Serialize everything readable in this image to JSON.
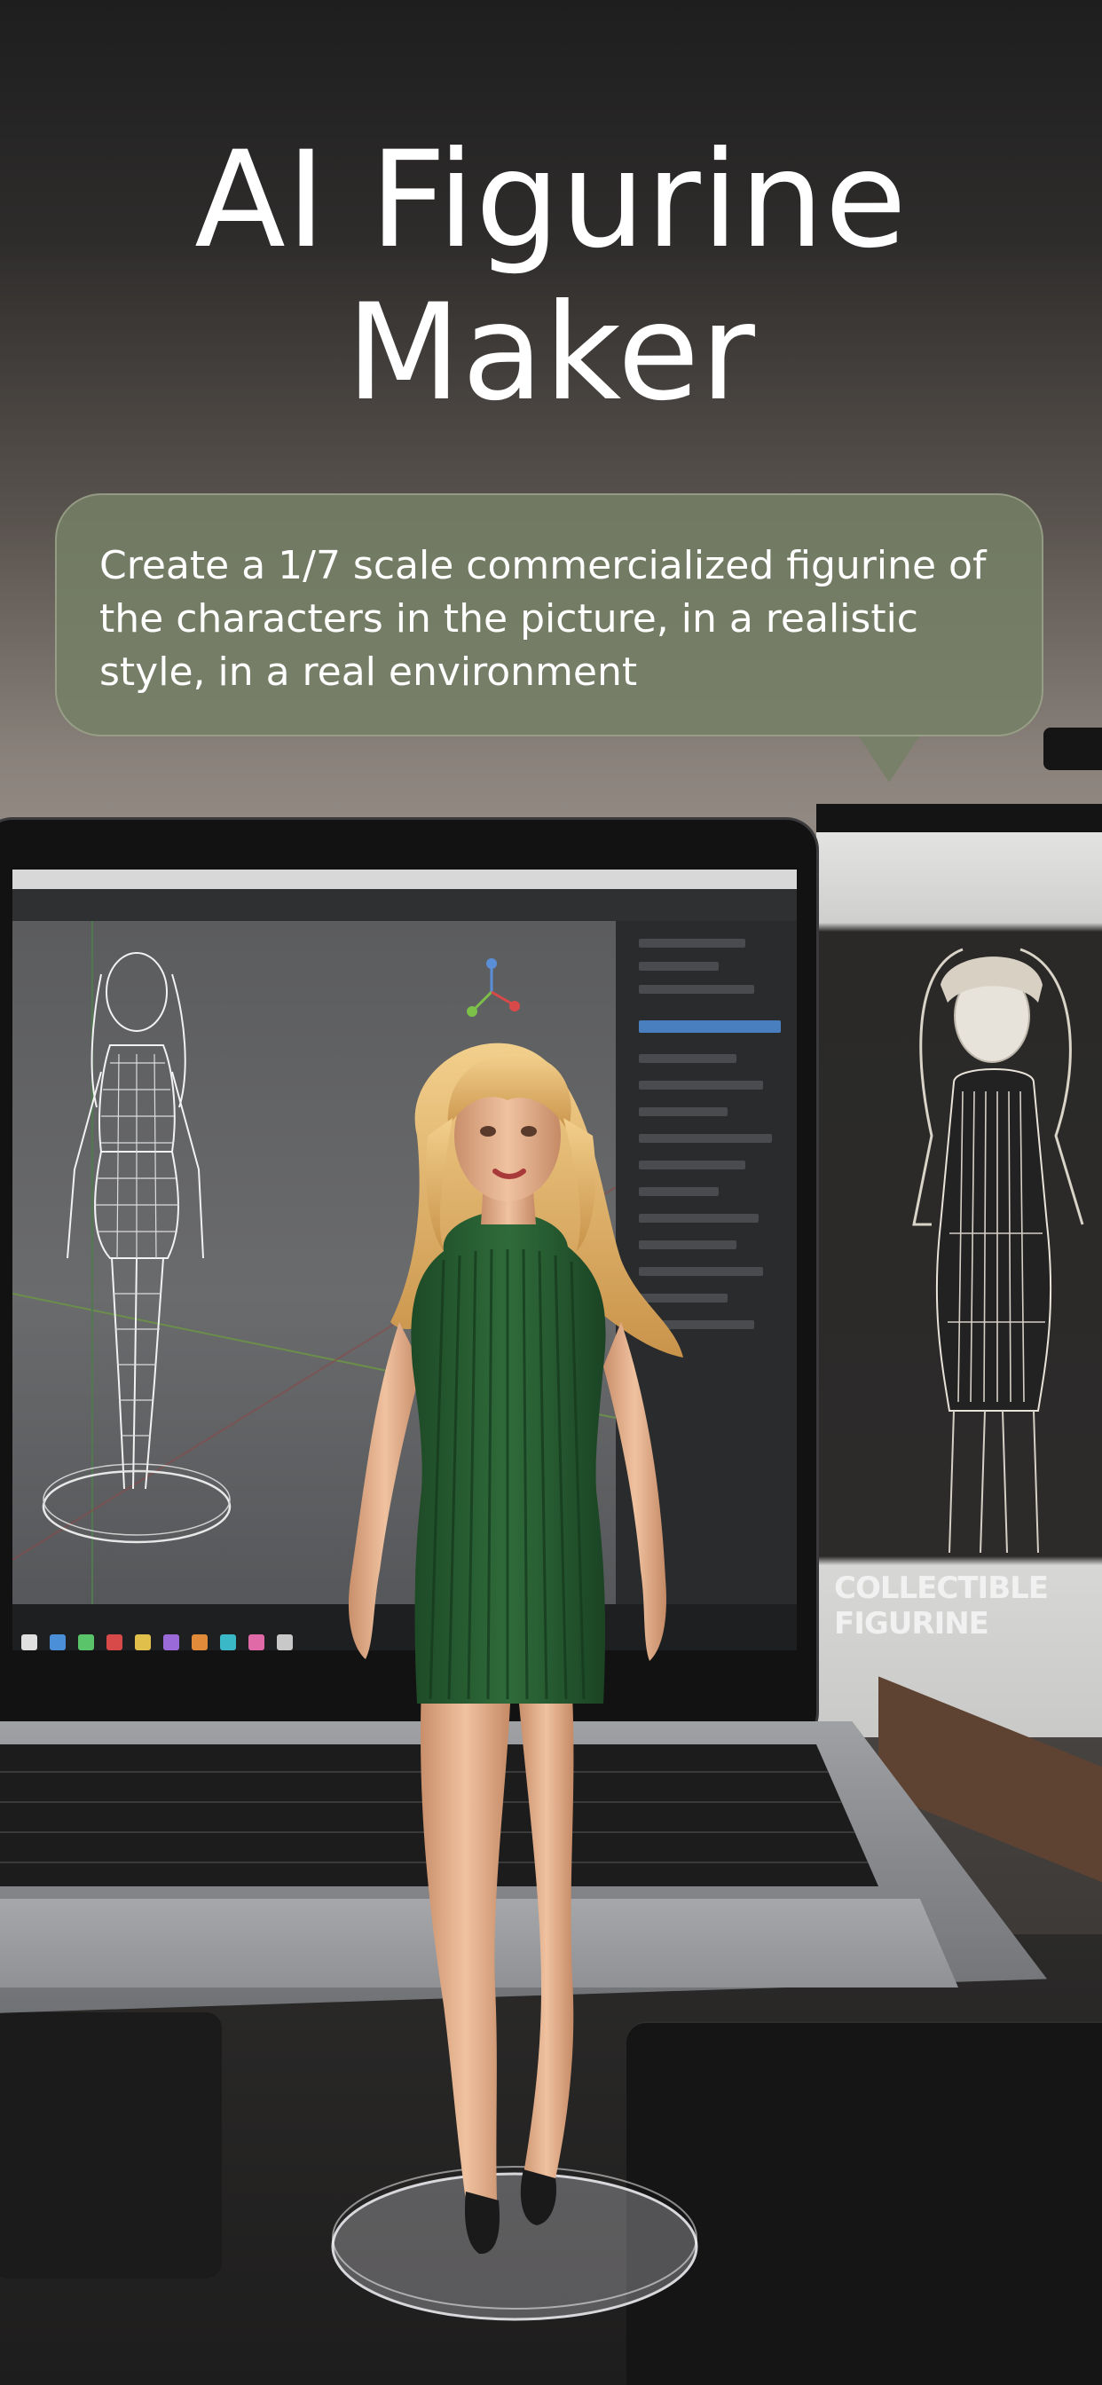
{
  "headline": {
    "line1": "AI Figurine",
    "line2": "Maker"
  },
  "prompt_bubble": {
    "text": "Create a 1/7 scale commercialized figurine of the characters in the picture, in a realistic style, in a real environment"
  },
  "scene": {
    "box_label": "COLLECTIBLE FIGURINE",
    "colors": {
      "bubble": "#768066",
      "dress": "#2f6b3a",
      "hair": "#e2b874"
    }
  }
}
